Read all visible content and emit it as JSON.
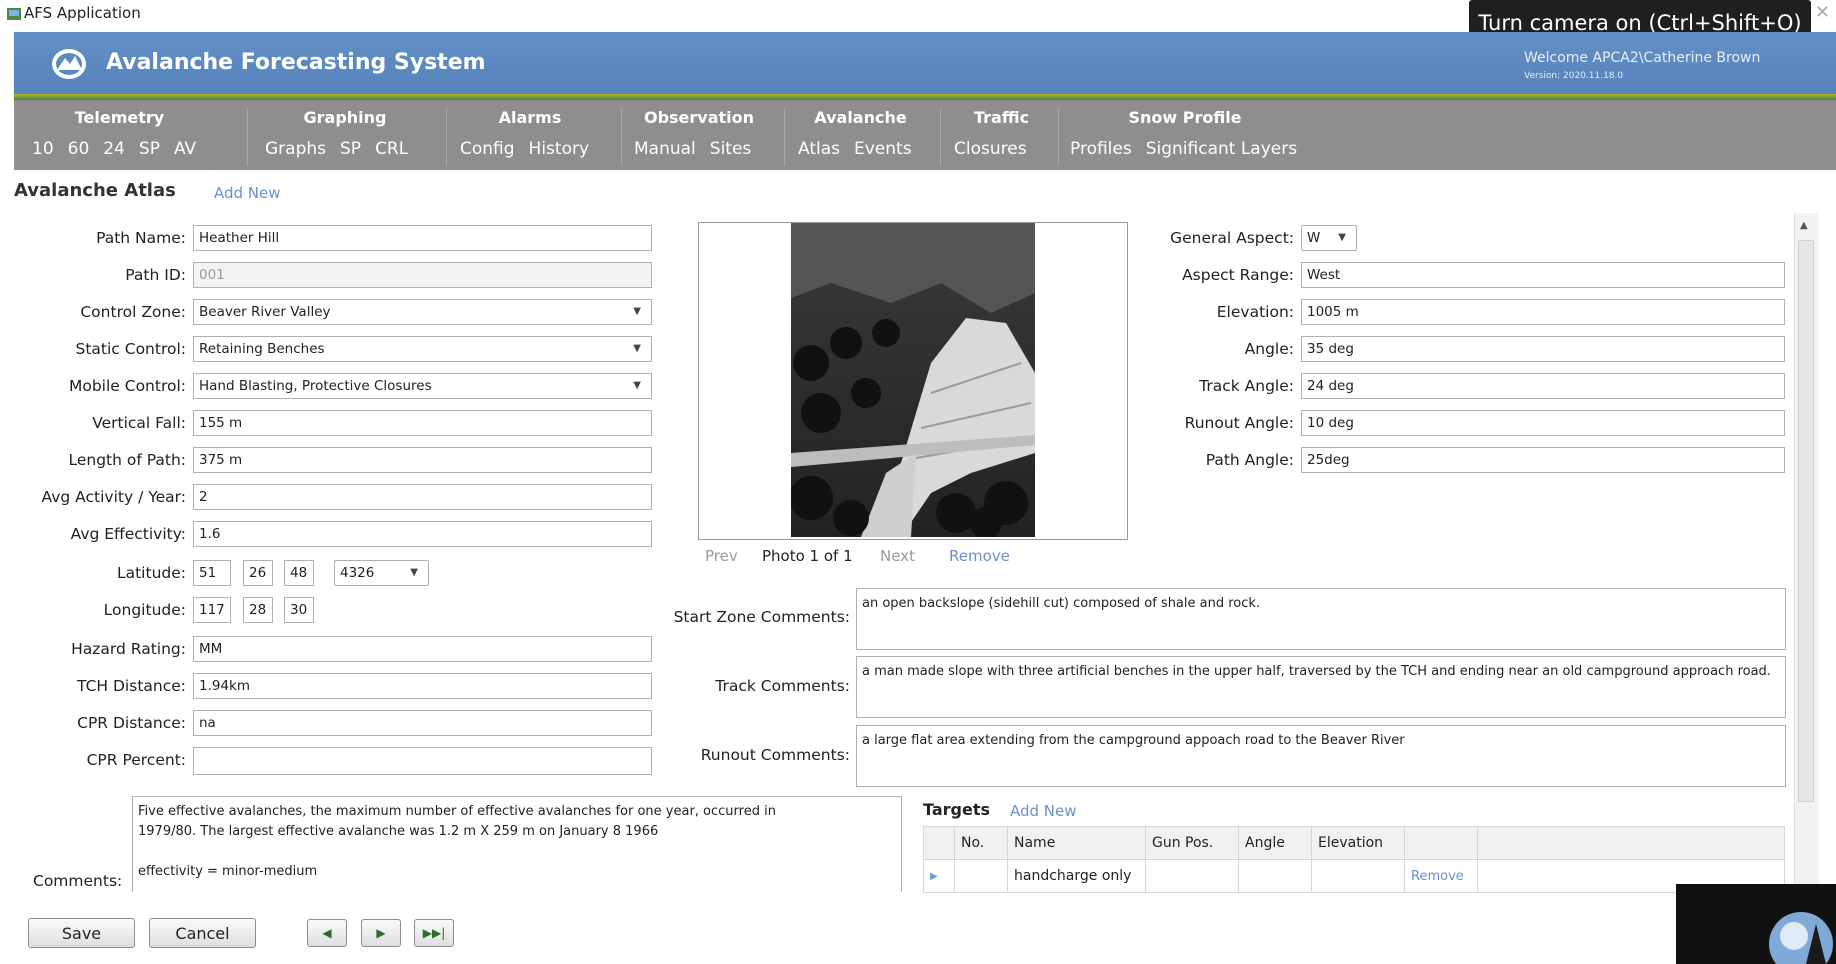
{
  "window": {
    "title": "AFS Application",
    "camera_tooltip": "Turn camera on (Ctrl+Shift+O)"
  },
  "header": {
    "title": "Avalanche Forecasting System",
    "welcome": "Welcome APCA2\\Catherine Brown",
    "version": "Version: 2020.11.18.0"
  },
  "nav": [
    {
      "group": "Telemetry",
      "links": [
        "10",
        "60",
        "24",
        "SP",
        "AV"
      ]
    },
    {
      "group": "Graphing",
      "links": [
        "Graphs",
        "SP",
        "CRL"
      ]
    },
    {
      "group": "Alarms",
      "links": [
        "Config",
        "History"
      ]
    },
    {
      "group": "Observation",
      "links": [
        "Manual",
        "Sites"
      ]
    },
    {
      "group": "Avalanche",
      "links": [
        "Atlas",
        "Events"
      ]
    },
    {
      "group": "Traffic",
      "links": [
        "Closures"
      ]
    },
    {
      "group": "Snow Profile",
      "links": [
        "Profiles",
        "Significant Layers"
      ]
    }
  ],
  "page": {
    "title": "Avalanche Atlas",
    "add_new": "Add New"
  },
  "form_left": {
    "path_name": {
      "label": "Path Name:",
      "value": "Heather Hill"
    },
    "path_id": {
      "label": "Path ID:",
      "value": "001"
    },
    "control_zone": {
      "label": "Control Zone:",
      "value": "Beaver River Valley"
    },
    "static_control": {
      "label": "Static Control:",
      "value": "Retaining Benches"
    },
    "mobile_control": {
      "label": "Mobile Control:",
      "value": "Hand Blasting, Protective Closures"
    },
    "vertical_fall": {
      "label": "Vertical Fall:",
      "value": "155 m"
    },
    "length_of_path": {
      "label": "Length of Path:",
      "value": "375 m"
    },
    "avg_activity": {
      "label": "Avg Activity / Year:",
      "value": "2"
    },
    "avg_effectivity": {
      "label": "Avg Effectivity:",
      "value": "1.6"
    },
    "latitude": {
      "label": "Latitude:",
      "deg": "51",
      "min": "26",
      "sec": "48",
      "datum": "4326"
    },
    "longitude": {
      "label": "Longitude:",
      "deg": "117",
      "min": "28",
      "sec": "30"
    },
    "hazard_rating": {
      "label": "Hazard Rating:",
      "value": "MM"
    },
    "tch_distance": {
      "label": "TCH Distance:",
      "value": "1.94km"
    },
    "cpr_distance": {
      "label": "CPR Distance:",
      "value": "na"
    },
    "cpr_percent": {
      "label": "CPR Percent:",
      "value": ""
    }
  },
  "photo": {
    "prev": "Prev",
    "counter": "Photo 1 of 1",
    "next": "Next",
    "remove": "Remove"
  },
  "form_right": {
    "general_aspect": {
      "label": "General Aspect:",
      "value": "W"
    },
    "aspect_range": {
      "label": "Aspect Range:",
      "value": "West"
    },
    "elevation": {
      "label": "Elevation:",
      "value": "1005 m"
    },
    "angle": {
      "label": "Angle:",
      "value": "35 deg"
    },
    "track_angle": {
      "label": "Track Angle:",
      "value": "24 deg"
    },
    "runout_angle": {
      "label": "Runout Angle:",
      "value": "10 deg"
    },
    "path_angle": {
      "label": "Path Angle:",
      "value": "25deg"
    }
  },
  "comments_mid": {
    "start_zone": {
      "label": "Start Zone Comments:",
      "value": "an open backslope (sidehill cut) composed of shale and rock."
    },
    "track": {
      "label": "Track Comments:",
      "value": "a man made slope with three artificial benches in the upper half, traversed by the  TCH and ending near an old campground approach road."
    },
    "runout": {
      "label": "Runout Comments:",
      "value": "a large flat area extending from the campground appoach road to the Beaver River"
    }
  },
  "comments": {
    "label": "Comments:",
    "line1": "Five effective avalanches, the maximum number of effective avalanches for one year, occurred in",
    "line2": "1979/80.  The largest effective avalanche was 1.2 m X 259 m on January 8 1966",
    "line3": "effectivity = minor-medium"
  },
  "targets": {
    "title": "Targets",
    "add_new": "Add New",
    "columns": [
      "No.",
      "Name",
      "Gun Pos.",
      "Angle",
      "Elevation"
    ],
    "rows": [
      {
        "no": "",
        "name": "handcharge only",
        "gun_pos": "",
        "angle": "",
        "elevation": "",
        "action": "Remove"
      }
    ]
  },
  "buttons": {
    "save": "Save",
    "cancel": "Cancel"
  },
  "colors": {
    "header": "#5a87bf",
    "nav": "#8e8e8e",
    "link": "#6b8fcf"
  }
}
